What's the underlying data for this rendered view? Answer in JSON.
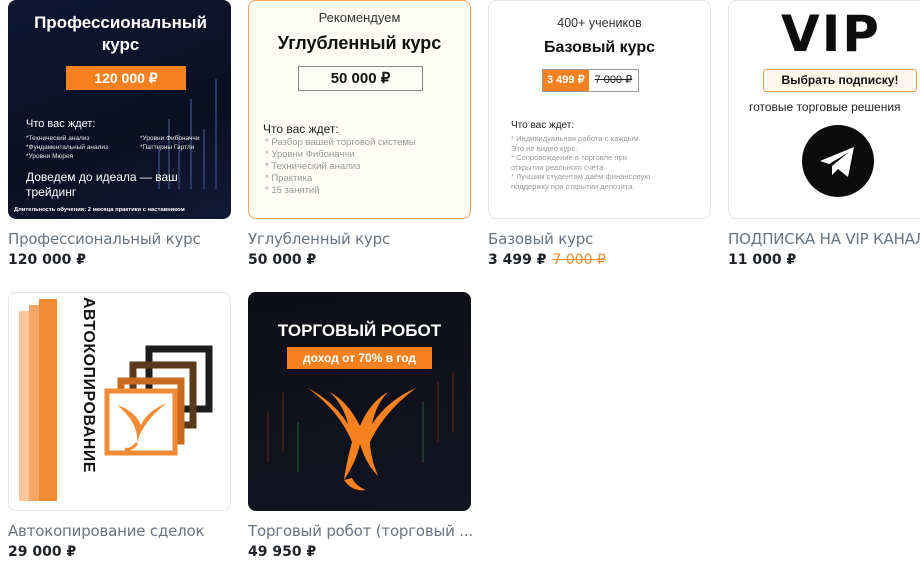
{
  "colors": {
    "accent": "#f7811e",
    "title_gray": "#6a7380",
    "price_dark": "#1f2328",
    "old_price": "#ee8b37"
  },
  "products": [
    {
      "title": "Профессиональный курс",
      "price": "120 000 ₽",
      "image": {
        "heading": "Профессиональный курс",
        "price_badge": "120 000 ₽",
        "wait_label": "Что вас ждет:",
        "list_left": [
          "*Технический анализ",
          "*Фундаментальный анализ",
          "*Уровни Мюрея"
        ],
        "list_right": [
          "*Уровни Фибоначчи",
          "*Паттерны Гартли"
        ],
        "closing": "Доведем до идеала — ваш трейдинг",
        "footer": "Длительность обучения: 2 месяца практики с наставником"
      }
    },
    {
      "title": "Углубленный курс",
      "price": "50 000 ₽",
      "image": {
        "top_label": "Рекомендуем",
        "heading": "Углубленный курс",
        "price_box": "50 000 ₽",
        "wait_label": "Что вас ждет:",
        "list": [
          "*  Разбор вашей торговой системы",
          "*  Уровни Фибоначчи",
          "*  Технический анализ",
          "*  Практика",
          "*  15 занятий"
        ]
      }
    },
    {
      "title": "Базовый курс",
      "price": "3 499 ₽",
      "old_price": "7 000 ₽",
      "image": {
        "top_label": "400+ учеников",
        "heading": "Базовый курс",
        "new_price": "3 499 ₽",
        "old_price": "7 000 ₽",
        "wait_label": "Что вас ждет:",
        "list": [
          "* Индивидуальная работа с каждым.",
          "Это не видео курс.",
          "* Сопровождение в торговле при",
          "открытии реального счёта.",
          "* Лучшим студентам даём финансовую",
          "поддержку при открытии депозита."
        ]
      }
    },
    {
      "title": "ПОДПИСКА НА VIP КАНАЛ",
      "price": "11 000 ₽",
      "image": {
        "heading": "VIP",
        "button": "Выбрать подписку!",
        "desc": "готовые торговые решения",
        "icon": "telegram-icon"
      }
    },
    {
      "title": "Автокопирование сделок",
      "price": "29 000 ₽",
      "image": {
        "vertical_text": "АВТОКОПИРОВАНИЕ",
        "icon": "phoenix-copy-icon"
      }
    },
    {
      "title": "Торговый робот (торговый ...",
      "price": "49 950 ₽",
      "image": {
        "heading": "ТОРГОВЫЙ РОБОТ",
        "badge": "доход от 70% в год",
        "icon": "phoenix-icon"
      }
    }
  ]
}
